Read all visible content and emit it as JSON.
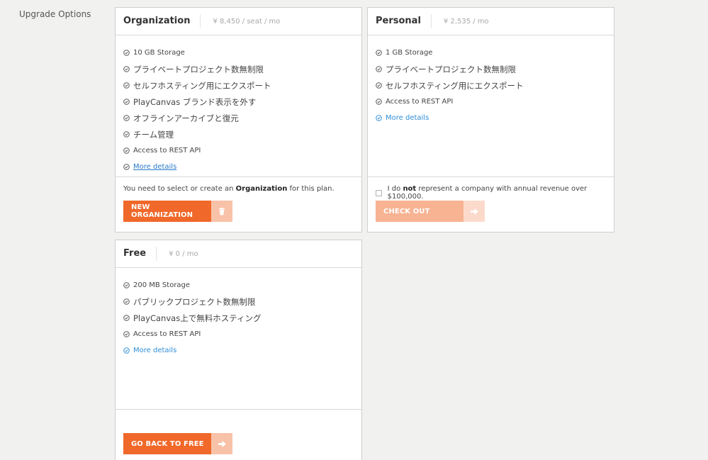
{
  "page": {
    "section_label": "Upgrade Options"
  },
  "colors": {
    "accent": "#f0682a",
    "accent_light": "#f9b190",
    "accent_side_light": "#f8c8b0",
    "accent_side_faint": "#fcdccf",
    "link": "#2f8ed6"
  },
  "organization": {
    "title": "Organization",
    "price": "¥ 8,450 / seat / mo",
    "features": [
      "10 GB Storage",
      "プライベートプロジェクト数無制限",
      "セルフホスティング用にエクスポート",
      "PlayCanvas ブランド表示を外す",
      "オフラインアーカイブと復元",
      "チーム管理",
      "Access to REST API"
    ],
    "more_details": "More details",
    "note_prefix": "You need to select or create an ",
    "note_bold": "Organization",
    "note_suffix": " for this plan.",
    "button_label": "NEW ORGANIZATION",
    "button_icon": "trash-icon"
  },
  "personal": {
    "title": "Personal",
    "price": "¥ 2,535 / mo",
    "features": [
      "1 GB Storage",
      "プライベートプロジェクト数無制限",
      "セルフホスティング用にエクスポート",
      "Access to REST API"
    ],
    "more_details": "More details",
    "checkbox_prefix": "I do ",
    "checkbox_bold": "not",
    "checkbox_suffix": " represent a company with annual revenue over $100,000.",
    "button_label": "CHECK OUT",
    "button_icon": "arrow-right-icon"
  },
  "free": {
    "title": "Free",
    "price": "¥ 0 / mo",
    "features": [
      "200 MB Storage",
      "パブリックプロジェクト数無制限",
      "PlayCanvas上で無料ホスティング",
      "Access to REST API"
    ],
    "more_details": "More details",
    "button_label": "GO BACK TO FREE",
    "button_icon": "arrow-right-icon"
  }
}
